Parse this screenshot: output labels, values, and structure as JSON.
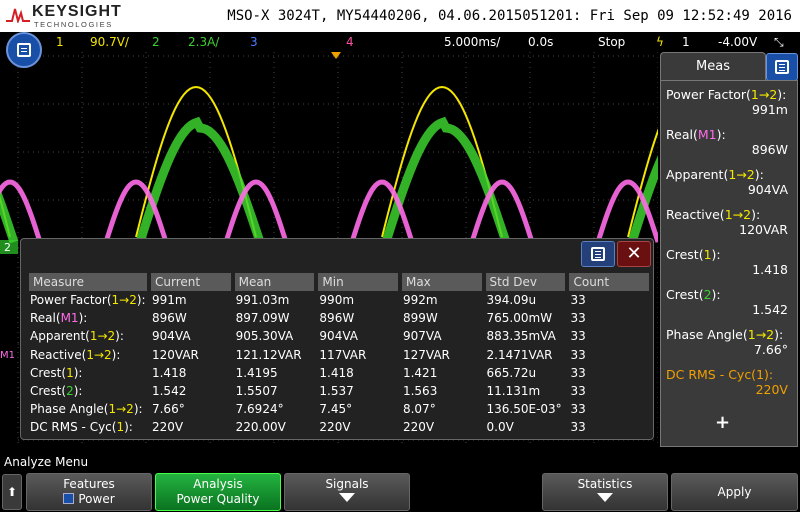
{
  "header": {
    "brand": "KEYSIGHT",
    "brand_sub": "TECHNOLOGIES",
    "title": "MSO-X 3024T, MY54440206, 04.06.2015051201: Fri Sep 09 12:52:49 2016"
  },
  "status": {
    "ch1": "1",
    "ch1_scale": "90.7V/",
    "ch2": "2",
    "ch2_scale": "2.3A/",
    "ch3": "3",
    "ch4": "4",
    "timebase": "5.000ms/",
    "delay": "0.0s",
    "run_state": "Stop",
    "trigger_src": "1",
    "trigger_level": "-4.00V"
  },
  "colors": {
    "ch1": "#f3e600",
    "ch2": "#3cd12e",
    "math": "#ff6be8",
    "ch3": "#4c7dff",
    "ch4": "#ff4da0",
    "accent": "#f0a000"
  },
  "table": {
    "headers": [
      "Measure",
      "Current",
      "Mean",
      "Min",
      "Max",
      "Std Dev",
      "Count"
    ],
    "rows": [
      {
        "name": "Power Factor(",
        "src": "1→2",
        "suffix": "):",
        "vals": [
          "991m",
          "991.03m",
          "990m",
          "992m",
          "394.09u",
          "33"
        ]
      },
      {
        "name": "Real(",
        "src": "M1",
        "suffix": "):",
        "vals": [
          "896W",
          "897.09W",
          "896W",
          "899W",
          "765.00mW",
          "33"
        ]
      },
      {
        "name": "Apparent(",
        "src": "1→2",
        "suffix": "):",
        "vals": [
          "904VA",
          "905.30VA",
          "904VA",
          "907VA",
          "883.35mVA",
          "33"
        ]
      },
      {
        "name": "Reactive(",
        "src": "1→2",
        "suffix": "):",
        "vals": [
          "120VAR",
          "121.12VAR",
          "117VAR",
          "127VAR",
          "2.1471VAR",
          "33"
        ]
      },
      {
        "name": "Crest(",
        "src": "1",
        "suffix": "):",
        "vals": [
          "1.418",
          "1.4195",
          "1.418",
          "1.421",
          "665.72u",
          "33"
        ]
      },
      {
        "name": "Crest(",
        "src": "2",
        "suffix": "):",
        "vals": [
          "1.542",
          "1.5507",
          "1.537",
          "1.563",
          "11.131m",
          "33"
        ]
      },
      {
        "name": "Phase Angle(",
        "src": "1→2",
        "suffix": "):",
        "vals": [
          "7.66°",
          "7.6924°",
          "7.45°",
          "8.07°",
          "136.50E-03°",
          "33"
        ]
      },
      {
        "name": "DC RMS - Cyc(",
        "src": "1",
        "suffix": "):",
        "vals": [
          "220V",
          "220.00V",
          "220V",
          "220V",
          "0.0V",
          "33"
        ]
      }
    ]
  },
  "meas_panel": {
    "tab": "Meas",
    "items": [
      {
        "name": "Power Factor(",
        "src": "1→2",
        "suffix": "):",
        "value": "991m"
      },
      {
        "name": "Real(",
        "src": "M1",
        "suffix": "):",
        "value": "896W"
      },
      {
        "name": "Apparent(",
        "src": "1→2",
        "suffix": "):",
        "value": "904VA"
      },
      {
        "name": "Reactive(",
        "src": "1→2",
        "suffix": "):",
        "value": "120VAR"
      },
      {
        "name": "Crest(",
        "src": "1",
        "suffix": "):",
        "value": "1.418"
      },
      {
        "name": "Crest(",
        "src": "2",
        "suffix": "):",
        "value": "1.542"
      },
      {
        "name": "Phase Angle(",
        "src": "1→2",
        "suffix": "):",
        "value": "7.66°"
      },
      {
        "name": "DC RMS - Cyc(",
        "src": "1",
        "suffix": "):",
        "value": "220V"
      }
    ],
    "add": "+"
  },
  "softkeys": {
    "menu_label": "Analyze Menu",
    "features": {
      "top": "Features",
      "bottom": "Power"
    },
    "analysis": {
      "top": "Analysis",
      "bottom": "Power Quality"
    },
    "signals": {
      "top": "Signals"
    },
    "statistics": {
      "top": "Statistics"
    },
    "apply": {
      "top": "Apply"
    }
  },
  "markers": {
    "left_ch2": "2",
    "left_m1": "M1"
  }
}
